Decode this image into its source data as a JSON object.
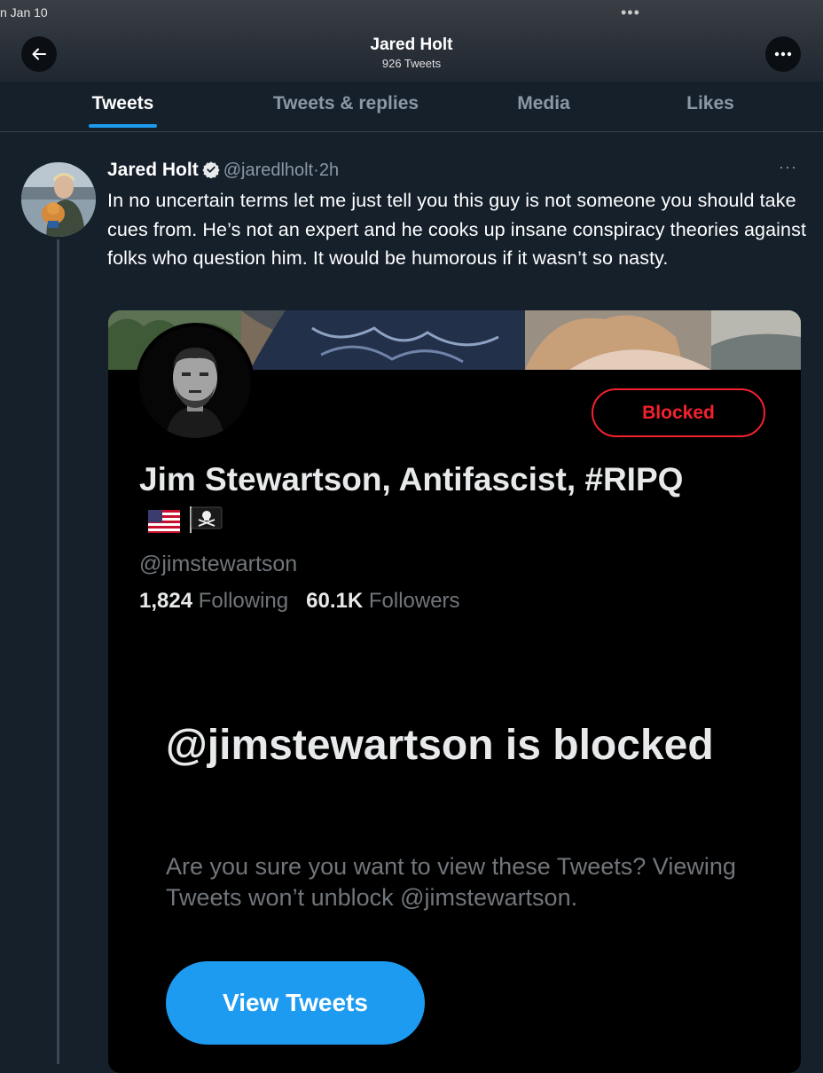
{
  "status_bar": {
    "date_fragment": "n Jan 10",
    "dots": "•••"
  },
  "header": {
    "title": "Jared Holt",
    "subtitle": "926 Tweets"
  },
  "tabs": [
    {
      "label": "Tweets",
      "active": true
    },
    {
      "label": "Tweets & replies",
      "active": false
    },
    {
      "label": "Media",
      "active": false
    },
    {
      "label": "Likes",
      "active": false
    }
  ],
  "tweet": {
    "author_name": "Jared Holt",
    "handle": "@jaredlholt",
    "separator": "·",
    "time": "2h",
    "more": "···",
    "text": "In no uncertain terms let me just tell you this guy is not someone you should take cues from. He’s not an expert and he cooks up insane conspiracy theories against folks who question him. It would be humorous if it wasn’t so nasty."
  },
  "embedded": {
    "blocked_button": "Blocked",
    "profile_name": "Jim Stewartson, Antifascist, #RIPQ",
    "profile_handle": "@jimstewartson",
    "following_count": "1,824",
    "following_label": "Following",
    "followers_count": "60.1K",
    "followers_label": "Followers",
    "blocked_heading": "@jimstewartson is blocked",
    "blocked_desc": "Are you sure you want to view these Tweets? Viewing Tweets won’t unblock @jimstewartson.",
    "view_button": "View Tweets"
  },
  "colors": {
    "background": "#15202b",
    "accent": "#1d9bf0",
    "danger": "#f4212e",
    "muted": "#8b98a5"
  }
}
